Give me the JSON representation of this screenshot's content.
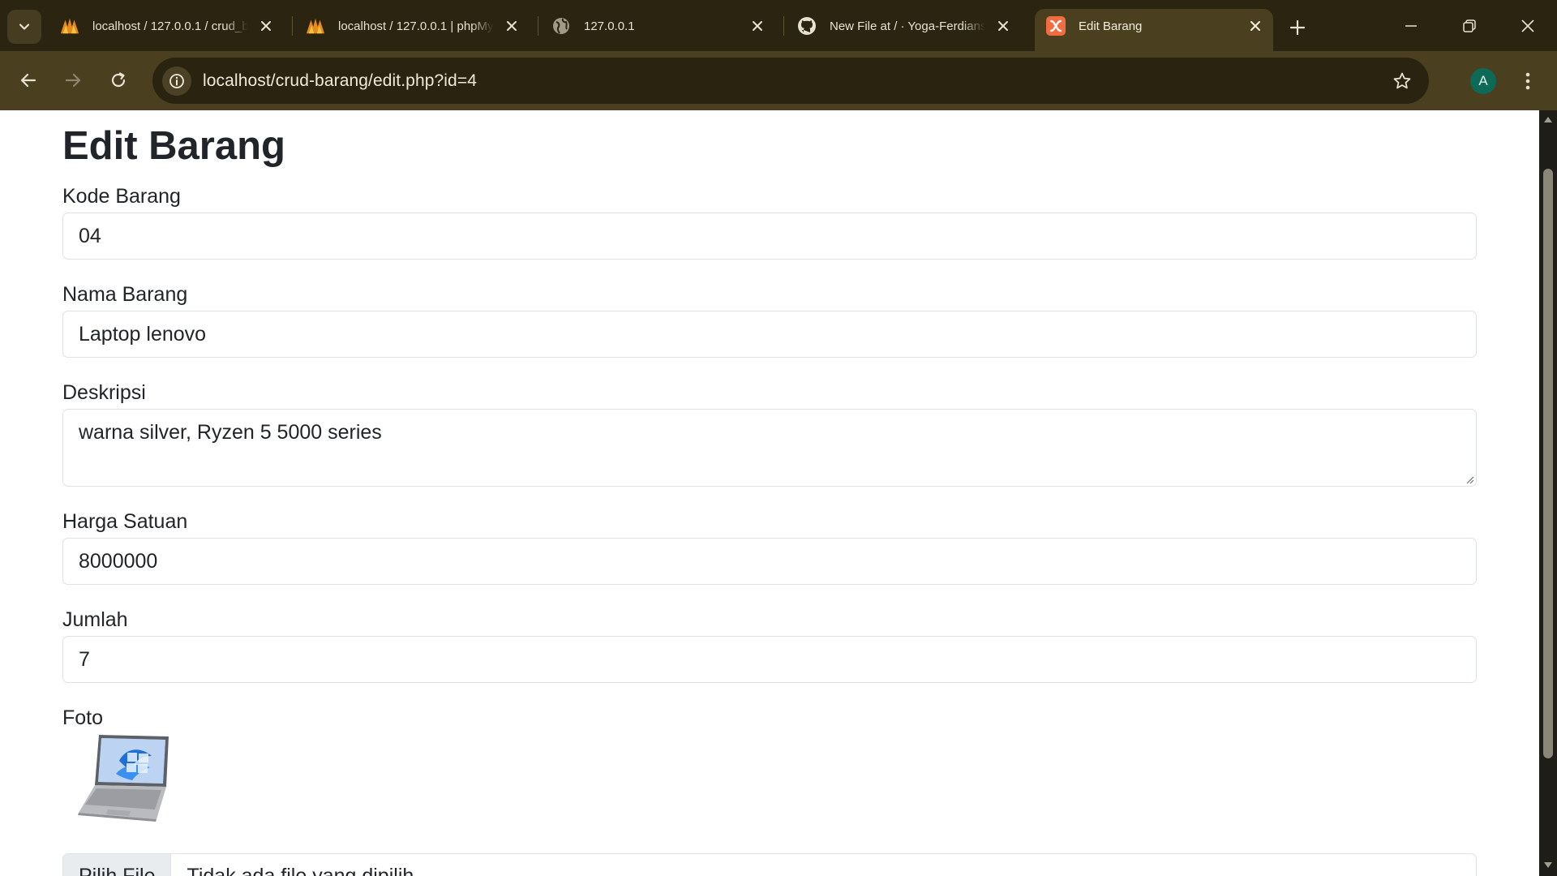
{
  "browser": {
    "tabs": [
      {
        "title": "localhost / 127.0.0.1 / crud_b",
        "icon": "phpmyadmin-icon"
      },
      {
        "title": "localhost / 127.0.0.1 | phpMy",
        "icon": "phpmyadmin-icon"
      },
      {
        "title": "127.0.0.1",
        "icon": "globe-icon"
      },
      {
        "title": "New File at / · Yoga-Ferdians",
        "icon": "github-icon"
      },
      {
        "title": "Edit Barang",
        "icon": "xampp-icon",
        "active": true
      }
    ],
    "url": "localhost/crud-barang/edit.php?id=4",
    "profile_initial": "A"
  },
  "page": {
    "heading": "Edit Barang",
    "fields": {
      "kode": {
        "label": "Kode Barang",
        "value": "04"
      },
      "nama": {
        "label": "Nama Barang",
        "value": "Laptop lenovo"
      },
      "deskripsi": {
        "label": "Deskripsi",
        "value": "warna silver, Ryzen 5 5000 series"
      },
      "harga": {
        "label": "Harga Satuan",
        "value": "8000000"
      },
      "jumlah": {
        "label": "Jumlah",
        "value": "7"
      },
      "foto": {
        "label": "Foto",
        "button_label": "Pilih File",
        "status": "Tidak ada file yang dipilih"
      }
    }
  },
  "colors": {
    "tabstrip": "#2b2410",
    "toolbar": "#4a3f1f",
    "text": "#212529",
    "border": "#dee2e6"
  }
}
